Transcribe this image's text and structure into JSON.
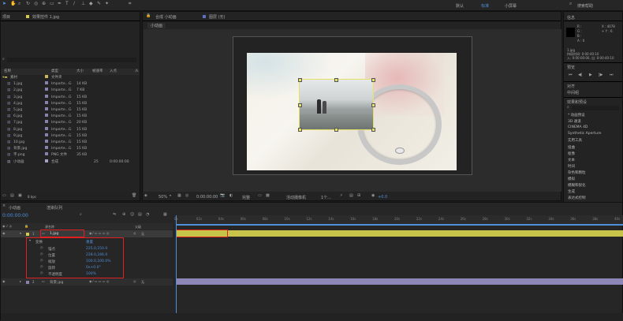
{
  "menu": {
    "workspace": "默认",
    "workspace_active": "标准",
    "workspace_small": "小屏幕",
    "search_placeholder": "搜索帮助"
  },
  "project": {
    "tab": "项目",
    "effects_tab": "效果控件 1.jpg",
    "search_icon": "search-icon",
    "columns": [
      "名称",
      "类型",
      "大小",
      "帧速率",
      "入点"
    ],
    "items": [
      {
        "name": "素材",
        "type": "文件夹",
        "size": "",
        "fps": "",
        "in": "",
        "color": "#c9b75a",
        "folder": true
      },
      {
        "name": "1.jpg",
        "type": "Importe...G",
        "size": "14 KB",
        "fps": "",
        "in": "",
        "color": "#8a7fb0"
      },
      {
        "name": "2.jpg",
        "type": "Importe...G",
        "size": "7 KB",
        "fps": "",
        "in": "",
        "color": "#8a7fb0"
      },
      {
        "name": "3.jpg",
        "type": "Importe...G",
        "size": "15 KB",
        "fps": "",
        "in": "",
        "color": "#8a7fb0"
      },
      {
        "name": "4.jpg",
        "type": "Importe...G",
        "size": "15 KB",
        "fps": "",
        "in": "",
        "color": "#8a7fb0"
      },
      {
        "name": "5.jpg",
        "type": "Importe...G",
        "size": "15 KB",
        "fps": "",
        "in": "",
        "color": "#8a7fb0"
      },
      {
        "name": "6.jpg",
        "type": "Importe...G",
        "size": "15 KB",
        "fps": "",
        "in": "",
        "color": "#8a7fb0"
      },
      {
        "name": "7.jpg",
        "type": "Importe...G",
        "size": "20 KB",
        "fps": "",
        "in": "",
        "color": "#8a7fb0"
      },
      {
        "name": "8.jpg",
        "type": "Importe...G",
        "size": "15 KB",
        "fps": "",
        "in": "",
        "color": "#8a7fb0"
      },
      {
        "name": "9.jpg",
        "type": "Importe...G",
        "size": "15 KB",
        "fps": "",
        "in": "",
        "color": "#8a7fb0"
      },
      {
        "name": "10.jpg",
        "type": "Importe...G",
        "size": "15 KB",
        "fps": "",
        "in": "",
        "color": "#8a7fb0"
      },
      {
        "name": "背景.jpg",
        "type": "Importe...G",
        "size": "15 KB",
        "fps": "",
        "in": "",
        "color": "#8a7fb0"
      },
      {
        "name": "字.png",
        "type": "PNG 文件",
        "size": "35 KB",
        "fps": "",
        "in": "",
        "color": "#8a7fb0"
      },
      {
        "name": "小动画",
        "type": "合成",
        "size": "",
        "fps": "25",
        "in": "0:00:00:00",
        "color": "#a9a0c9"
      }
    ],
    "bpc": "8 bpc"
  },
  "composition": {
    "tab_label": "合成 小动画",
    "layer_label": "图层 (无)",
    "sub_tab": "小动画",
    "zoom": "50%",
    "timecode": "0:00:00:00",
    "quality": "完整",
    "camera": "活动摄像机",
    "views": "1个...",
    "exposure": "+0.0"
  },
  "info": {
    "tab": "信息",
    "x": "X : 4078",
    "r": "R :",
    "g": "G :",
    "b": "B :",
    "a": "A : 0",
    "y": "+ Y : 6",
    "file": "1.jpg",
    "duration": "持续时间: 0:00:40:10",
    "inout": "入: 0:00:00:00, 出: 0:00:40:10"
  },
  "preview": {
    "tab": "预览"
  },
  "tracker": {
    "tab": "对齐",
    "value": "中间组"
  },
  "effects": {
    "tab": "效果和预设",
    "search_icon": "search-icon",
    "items": [
      "* 动画预设",
      "3D 通道",
      "CINEMA 4D",
      "Synthetic Aperture",
      "实用工具",
      "扭曲",
      "抠像",
      "文本",
      "时间",
      "杂色和颗粒",
      "模拟",
      "模糊和锐化",
      "生成",
      "表达式控制"
    ]
  },
  "timeline": {
    "comp_tab": "小动画",
    "queue_tab": "渲染队列",
    "timecode": "0:00:00:00",
    "col_source": "源名称",
    "col_parent": "父级",
    "layers": [
      {
        "num": "1",
        "name": "1.jpg",
        "parent": "无",
        "color": "#d4c94a"
      },
      {
        "num": "2",
        "name": "背景.jpg",
        "parent": "无",
        "color": "#8a7fb0"
      }
    ],
    "transform_label": "变换",
    "reset_label": "重置",
    "properties": [
      {
        "name": "锚点",
        "value": "225.0,150.0"
      },
      {
        "name": "位置",
        "value": "228.0,246.0"
      },
      {
        "name": "缩放",
        "value": "100.0,100.0%"
      },
      {
        "name": "旋转",
        "value": "0x+0.0°"
      },
      {
        "name": "不透明度",
        "value": "100%"
      }
    ],
    "ruler": [
      "0s",
      "02s",
      "04s",
      "06s",
      "08s",
      "10s",
      "12s",
      "14s",
      "16s",
      "18s",
      "20s",
      "22s",
      "24s",
      "26s",
      "28s",
      "30s",
      "32s",
      "34s",
      "36s",
      "38s",
      "40s"
    ],
    "colors": {
      "accent": "#4f8ed8",
      "bar_yellow": "#c8c44a",
      "bar_purple": "#8d87b8",
      "highlight_red": "#e02020"
    }
  }
}
